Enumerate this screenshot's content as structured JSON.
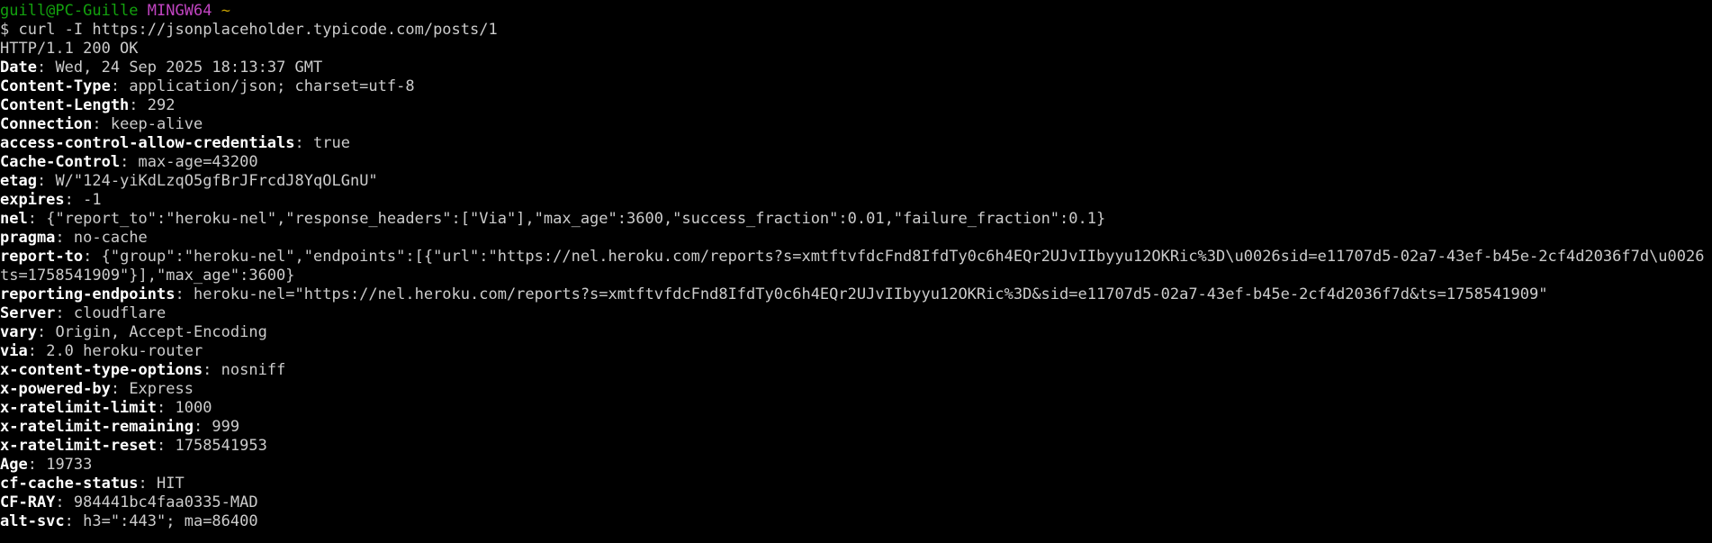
{
  "prompt": {
    "user_host": "guill@PC-Guille",
    "env": "MINGW64",
    "cwd": "~",
    "symbol": "$",
    "command": "curl -I https://jsonplaceholder.typicode.com/posts/1"
  },
  "status_line": "HTTP/1.1 200 OK",
  "headers": [
    {
      "name": "Date",
      "value": "Wed, 24 Sep 2025 18:13:37 GMT"
    },
    {
      "name": "Content-Type",
      "value": "application/json; charset=utf-8"
    },
    {
      "name": "Content-Length",
      "value": "292"
    },
    {
      "name": "Connection",
      "value": "keep-alive"
    },
    {
      "name": "access-control-allow-credentials",
      "value": "true"
    },
    {
      "name": "Cache-Control",
      "value": "max-age=43200"
    },
    {
      "name": "etag",
      "value": "W/\"124-yiKdLzqO5gfBrJFrcdJ8YqOLGnU\""
    },
    {
      "name": "expires",
      "value": "-1"
    },
    {
      "name": "nel",
      "value": "{\"report_to\":\"heroku-nel\",\"response_headers\":[\"Via\"],\"max_age\":3600,\"success_fraction\":0.01,\"failure_fraction\":0.1}"
    },
    {
      "name": "pragma",
      "value": "no-cache"
    },
    {
      "name": "report-to",
      "value": "{\"group\":\"heroku-nel\",\"endpoints\":[{\"url\":\"https://nel.heroku.com/reports?s=xmtftvfdcFnd8IfdTy0c6h4EQr2UJvIIbyyu12OKRic%3D\\u0026sid=e11707d5-02a7-43ef-b45e-2cf4d2036f7d\\u0026ts=1758541909\"}],\"max_age\":3600}"
    },
    {
      "name": "reporting-endpoints",
      "value": "heroku-nel=\"https://nel.heroku.com/reports?s=xmtftvfdcFnd8IfdTy0c6h4EQr2UJvIIbyyu12OKRic%3D&sid=e11707d5-02a7-43ef-b45e-2cf4d2036f7d&ts=1758541909\""
    },
    {
      "name": "Server",
      "value": "cloudflare"
    },
    {
      "name": "vary",
      "value": "Origin, Accept-Encoding"
    },
    {
      "name": "via",
      "value": "2.0 heroku-router"
    },
    {
      "name": "x-content-type-options",
      "value": "nosniff"
    },
    {
      "name": "x-powered-by",
      "value": "Express"
    },
    {
      "name": "x-ratelimit-limit",
      "value": "1000"
    },
    {
      "name": "x-ratelimit-remaining",
      "value": "999"
    },
    {
      "name": "x-ratelimit-reset",
      "value": "1758541953"
    },
    {
      "name": "Age",
      "value": "19733"
    },
    {
      "name": "cf-cache-status",
      "value": "HIT"
    },
    {
      "name": "CF-RAY",
      "value": "984441bc4faa0335-MAD"
    },
    {
      "name": "alt-svc",
      "value": "h3=\":443\"; ma=86400"
    }
  ],
  "colors": {
    "background": "#000000",
    "text": "#cccccc",
    "user_host": "#13a10e",
    "env": "#c044c0",
    "cwd": "#c19c00",
    "header_name": "#ffffff"
  }
}
